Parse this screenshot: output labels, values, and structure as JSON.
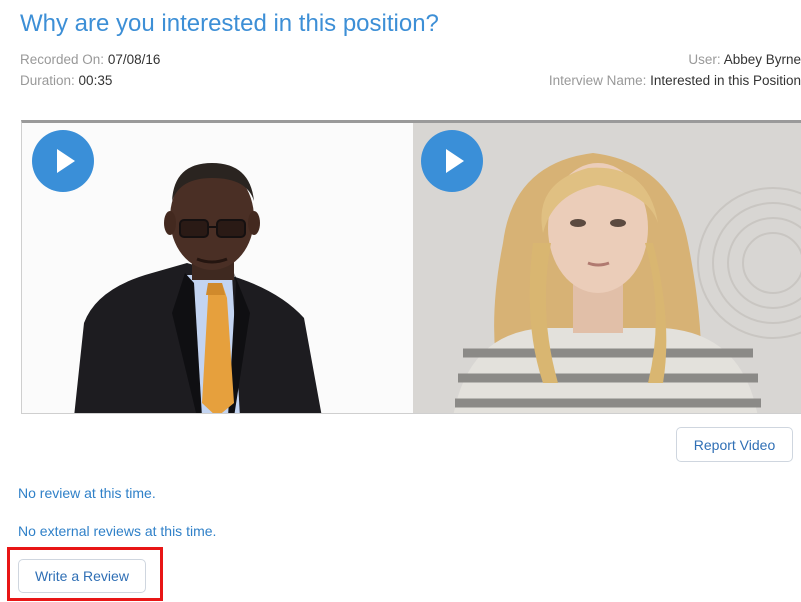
{
  "page": {
    "title": "Why are you interested in this position?"
  },
  "meta": {
    "recorded_on_label": "Recorded On:",
    "recorded_on_value": "07/08/16",
    "duration_label": "Duration:",
    "duration_value": "00:35",
    "user_label": "User:",
    "user_value": "Abbey Byrne",
    "interview_name_label": "Interview Name:",
    "interview_name_value": "Interested in this Position"
  },
  "video": {
    "left_play_icon": "play-icon",
    "right_play_icon": "play-icon"
  },
  "buttons": {
    "report_video": "Report Video",
    "write_review": "Write a Review"
  },
  "reviews": {
    "no_review": "No review at this time.",
    "no_external": "No external reviews at this time."
  },
  "colors": {
    "title": "#3d8fd6",
    "play_button": "#3a8fd8",
    "highlight": "#e81616",
    "link": "#2f80c8"
  }
}
